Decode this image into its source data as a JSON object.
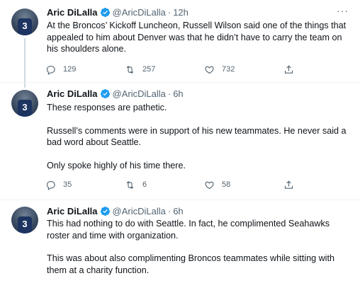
{
  "tweets": [
    {
      "name": "Aric DiLalla",
      "handle": "@AricDiLalla",
      "time": "12h",
      "paragraphs": [
        "At the Broncos’ Kickoff Luncheon, Russell Wilson said one of the things that appealed to him about Denver was that he didn’t have to carry the team on his shoulders alone."
      ],
      "replies": "129",
      "retweets": "257",
      "likes": "732"
    },
    {
      "name": "Aric DiLalla",
      "handle": "@AricDiLalla",
      "time": "6h",
      "paragraphs": [
        "These responses are pathetic.",
        "Russell’s comments were in support of his new teammates. He never said a bad word about Seattle.",
        "Only spoke highly of his time there."
      ],
      "replies": "35",
      "retweets": "6",
      "likes": "58"
    },
    {
      "name": "Aric DiLalla",
      "handle": "@AricDiLalla",
      "time": "6h",
      "paragraphs": [
        "This had nothing to do with Seattle. In fact, he complimented Seahawks roster and time with organization.",
        "This was about also complimenting Broncos teammates while sitting with them at a charity function."
      ]
    }
  ],
  "avatar_number": "3",
  "more_glyph": "···",
  "dot_separator": "·",
  "colors": {
    "verified": "#1d9bf0",
    "secondary_text": "#536471",
    "primary_text": "#0f1419",
    "divider": "#eff3f4",
    "thread_line": "#cfd9de"
  },
  "icons": {
    "verified": "verified-badge-icon",
    "reply": "reply-icon",
    "retweet": "retweet-icon",
    "like": "heart-icon",
    "share": "share-icon",
    "more": "more-icon"
  }
}
